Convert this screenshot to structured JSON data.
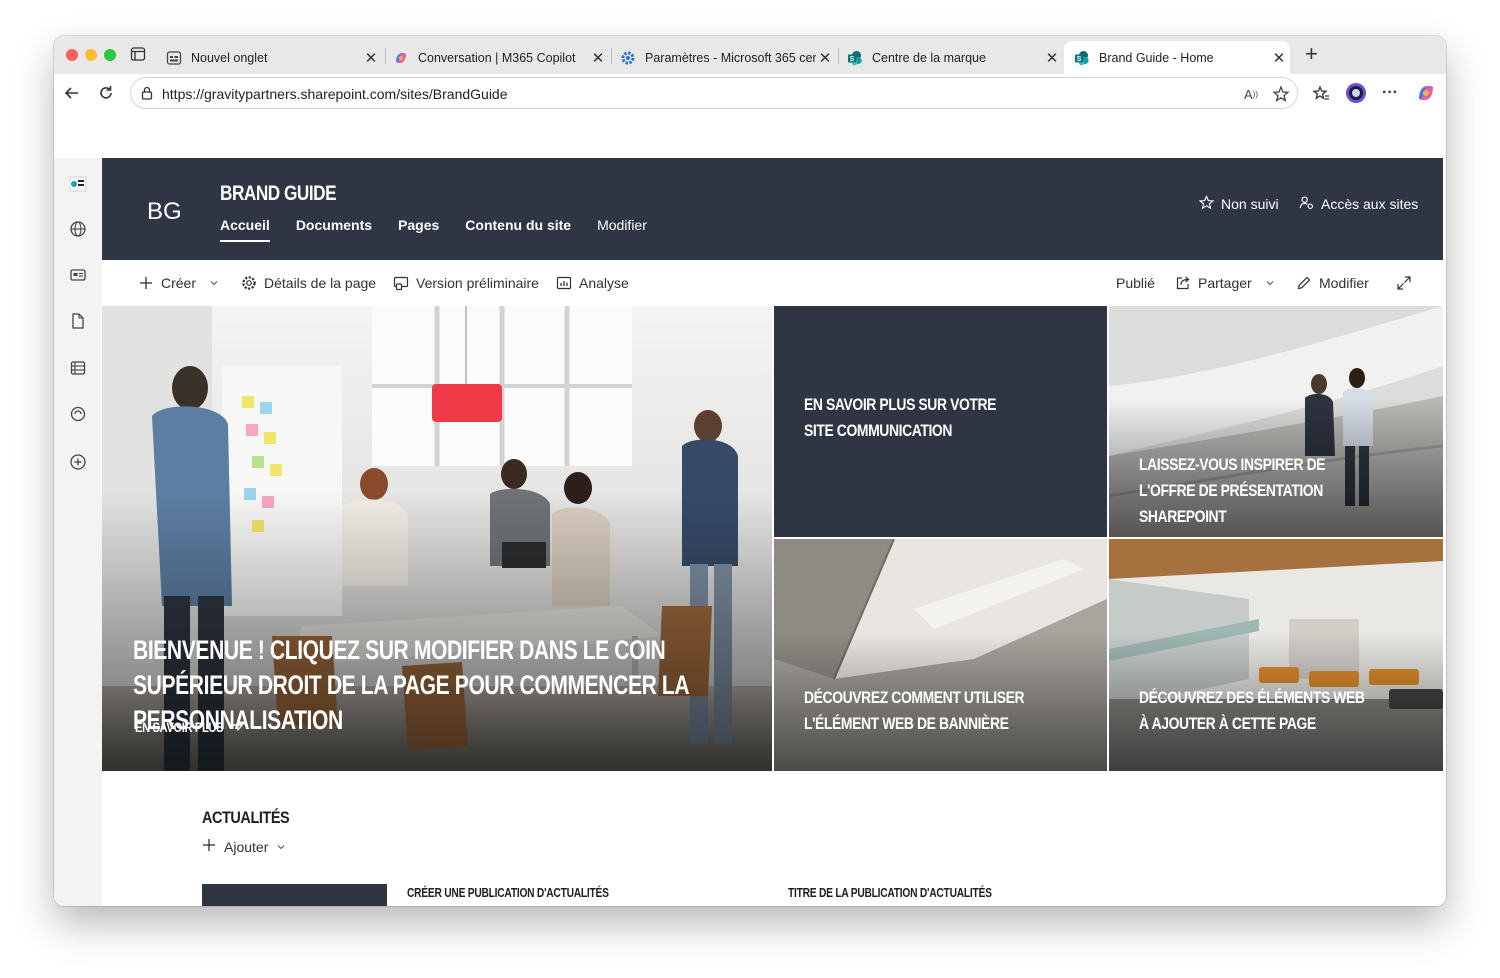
{
  "browser": {
    "tabs": [
      {
        "title": "Nouvel onglet"
      },
      {
        "title": "Conversation | M365 Copilot"
      },
      {
        "title": "Paramètres - Microsoft 365 cer"
      },
      {
        "title": "Centre de la marque"
      },
      {
        "title": "Brand Guide - Home"
      }
    ],
    "new_tab_label": "+",
    "url": "https://gravitypartners.sharepoint.com/sites/BrandGuide"
  },
  "site": {
    "logo_initials": "BG",
    "title": "BRAND GUIDE",
    "nav": [
      "Accueil",
      "Documents",
      "Pages",
      "Contenu du site",
      "Modifier"
    ],
    "follow_label": "Non suivi",
    "sites_access_label": "Accès aux sites"
  },
  "command_bar": {
    "create": "Créer",
    "page_details": "Détails de la page",
    "preview": "Version préliminaire",
    "analytics": "Analyse",
    "status": "Publié",
    "share": "Partager",
    "edit": "Modifier"
  },
  "hero": {
    "main_caption": "Bienvenue ! Cliquez sur Modifier dans le coin supérieur droit de la page pour commencer la personnalisation",
    "main_link": "En savoir plus",
    "tile_2": "En savoir plus sur votre site communication",
    "tile_3": "Laissez-vous inspirer de l'offre de présentation SharePoint",
    "tile_4": "Découvrez comment utiliser l'élément web de bannière",
    "tile_5": "Découvrez des éléments web à ajouter à cette page"
  },
  "news": {
    "title": "ACTUALITÉS",
    "add_label": "Ajouter",
    "items": [
      "CRÉER UNE PUBLICATION D'ACTUALITÉS",
      "TITRE DE LA PUBLICATION D'ACTUALITÉS"
    ]
  },
  "colors": {
    "header_bg": "#2f3542",
    "accent": "#ffffff"
  }
}
